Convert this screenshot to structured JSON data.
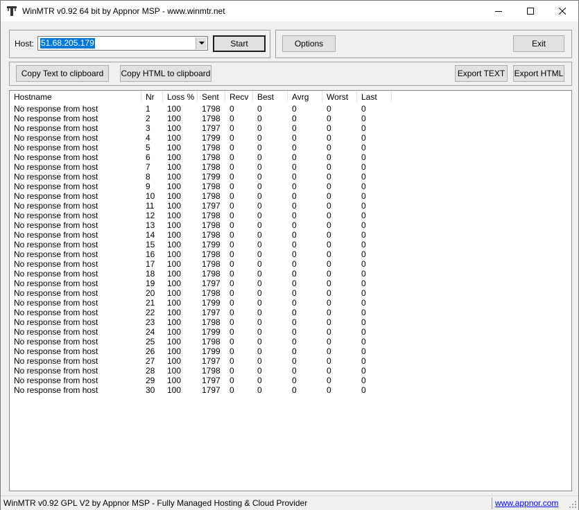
{
  "window": {
    "title": "WinMTR v0.92 64 bit by Appnor MSP - www.winmtr.net"
  },
  "host": {
    "label": "Host:",
    "value": "51.68.205.179"
  },
  "buttons": {
    "start": "Start",
    "options": "Options",
    "exit": "Exit",
    "copy_text": "Copy Text to clipboard",
    "copy_html": "Copy HTML to clipboard",
    "export_text": "Export TEXT",
    "export_html": "Export HTML"
  },
  "table": {
    "columns": [
      "Hostname",
      "Nr",
      "Loss %",
      "Sent",
      "Recv",
      "Best",
      "Avrg",
      "Worst",
      "Last"
    ],
    "rows": [
      [
        "No response from host",
        "1",
        "100",
        "1798",
        "0",
        "0",
        "0",
        "0",
        "0"
      ],
      [
        "No response from host",
        "2",
        "100",
        "1798",
        "0",
        "0",
        "0",
        "0",
        "0"
      ],
      [
        "No response from host",
        "3",
        "100",
        "1797",
        "0",
        "0",
        "0",
        "0",
        "0"
      ],
      [
        "No response from host",
        "4",
        "100",
        "1799",
        "0",
        "0",
        "0",
        "0",
        "0"
      ],
      [
        "No response from host",
        "5",
        "100",
        "1798",
        "0",
        "0",
        "0",
        "0",
        "0"
      ],
      [
        "No response from host",
        "6",
        "100",
        "1798",
        "0",
        "0",
        "0",
        "0",
        "0"
      ],
      [
        "No response from host",
        "7",
        "100",
        "1798",
        "0",
        "0",
        "0",
        "0",
        "0"
      ],
      [
        "No response from host",
        "8",
        "100",
        "1799",
        "0",
        "0",
        "0",
        "0",
        "0"
      ],
      [
        "No response from host",
        "9",
        "100",
        "1798",
        "0",
        "0",
        "0",
        "0",
        "0"
      ],
      [
        "No response from host",
        "10",
        "100",
        "1798",
        "0",
        "0",
        "0",
        "0",
        "0"
      ],
      [
        "No response from host",
        "11",
        "100",
        "1797",
        "0",
        "0",
        "0",
        "0",
        "0"
      ],
      [
        "No response from host",
        "12",
        "100",
        "1798",
        "0",
        "0",
        "0",
        "0",
        "0"
      ],
      [
        "No response from host",
        "13",
        "100",
        "1798",
        "0",
        "0",
        "0",
        "0",
        "0"
      ],
      [
        "No response from host",
        "14",
        "100",
        "1798",
        "0",
        "0",
        "0",
        "0",
        "0"
      ],
      [
        "No response from host",
        "15",
        "100",
        "1799",
        "0",
        "0",
        "0",
        "0",
        "0"
      ],
      [
        "No response from host",
        "16",
        "100",
        "1798",
        "0",
        "0",
        "0",
        "0",
        "0"
      ],
      [
        "No response from host",
        "17",
        "100",
        "1798",
        "0",
        "0",
        "0",
        "0",
        "0"
      ],
      [
        "No response from host",
        "18",
        "100",
        "1798",
        "0",
        "0",
        "0",
        "0",
        "0"
      ],
      [
        "No response from host",
        "19",
        "100",
        "1797",
        "0",
        "0",
        "0",
        "0",
        "0"
      ],
      [
        "No response from host",
        "20",
        "100",
        "1798",
        "0",
        "0",
        "0",
        "0",
        "0"
      ],
      [
        "No response from host",
        "21",
        "100",
        "1799",
        "0",
        "0",
        "0",
        "0",
        "0"
      ],
      [
        "No response from host",
        "22",
        "100",
        "1797",
        "0",
        "0",
        "0",
        "0",
        "0"
      ],
      [
        "No response from host",
        "23",
        "100",
        "1798",
        "0",
        "0",
        "0",
        "0",
        "0"
      ],
      [
        "No response from host",
        "24",
        "100",
        "1799",
        "0",
        "0",
        "0",
        "0",
        "0"
      ],
      [
        "No response from host",
        "25",
        "100",
        "1798",
        "0",
        "0",
        "0",
        "0",
        "0"
      ],
      [
        "No response from host",
        "26",
        "100",
        "1799",
        "0",
        "0",
        "0",
        "0",
        "0"
      ],
      [
        "No response from host",
        "27",
        "100",
        "1797",
        "0",
        "0",
        "0",
        "0",
        "0"
      ],
      [
        "No response from host",
        "28",
        "100",
        "1798",
        "0",
        "0",
        "0",
        "0",
        "0"
      ],
      [
        "No response from host",
        "29",
        "100",
        "1797",
        "0",
        "0",
        "0",
        "0",
        "0"
      ],
      [
        "No response from host",
        "30",
        "100",
        "1797",
        "0",
        "0",
        "0",
        "0",
        "0"
      ]
    ]
  },
  "status": {
    "text": "WinMTR v0.92 GPL V2 by Appnor MSP - Fully Managed Hosting & Cloud Provider",
    "link": "www.appnor.com"
  },
  "colors": {
    "selection": "#0078d7",
    "link": "#0000ff",
    "face": "#f0f0f0"
  },
  "icons": {
    "app": "winmtr-app-icon",
    "minimize": "minimize-icon",
    "maximize": "maximize-icon",
    "close": "close-icon",
    "dropdown": "chevron-down-icon",
    "grip": "resize-grip-icon"
  }
}
